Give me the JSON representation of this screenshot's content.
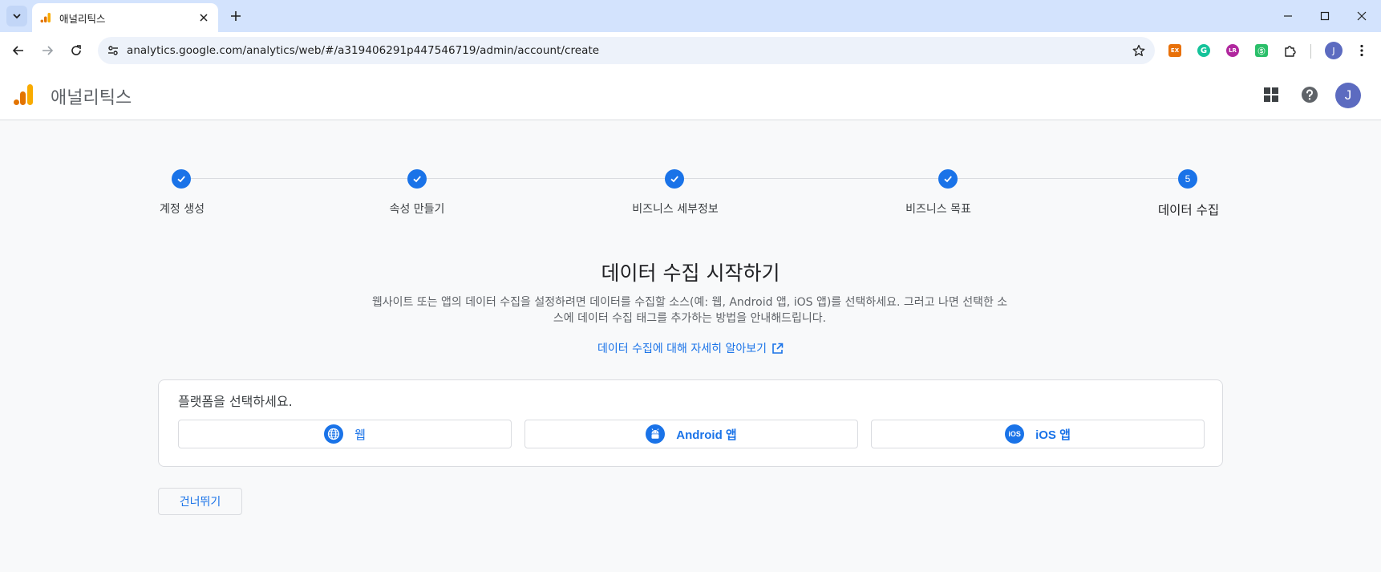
{
  "browser": {
    "tab_title": "애널리틱스",
    "url": "analytics.google.com/analytics/web/#/a319406291p447546719/admin/account/create",
    "profile_initial": "J",
    "extensions": [
      {
        "name": "ex-extension-icon",
        "label": "EX",
        "color": "#e8710a"
      },
      {
        "name": "grammarly-extension-icon",
        "label": "G",
        "color": "#15c39a"
      },
      {
        "name": "lr-extension-icon",
        "label": "LR",
        "color": "#b0279e"
      },
      {
        "name": "green-extension-icon",
        "label": "Ⓢ",
        "color": "#2bbf6a"
      }
    ]
  },
  "header": {
    "app_title": "애널리틱스",
    "avatar_initial": "J"
  },
  "stepper": {
    "steps": [
      {
        "label": "계정 생성",
        "done": true
      },
      {
        "label": "속성 만들기",
        "done": true
      },
      {
        "label": "비즈니스 세부정보",
        "done": true
      },
      {
        "label": "비즈니스 목표",
        "done": true
      },
      {
        "label": "데이터 수집",
        "done": false,
        "number": "5"
      }
    ]
  },
  "main": {
    "title": "데이터 수집 시작하기",
    "description": "웹사이트 또는 앱의 데이터 수집을 설정하려면 데이터를 수집할 소스(예: 웹, Android 앱, iOS 앱)를 선택하세요. 그러고 나면 선택한 소스에 데이터 수집 태그를 추가하는 방법을 안내해드립니다.",
    "learn_more": "데이터 수집에 대해 자세히 알아보기",
    "platform_prompt": "플랫폼을 선택하세요.",
    "platforms": {
      "web": "웹",
      "android": "Android 앱",
      "ios": "iOS 앱",
      "ios_badge": "iOS"
    },
    "skip_label": "건너뛰기"
  },
  "colors": {
    "accent": "#1a73e8",
    "tabstrip": "#d3e3fd",
    "avatar": "#5c6bc0"
  }
}
